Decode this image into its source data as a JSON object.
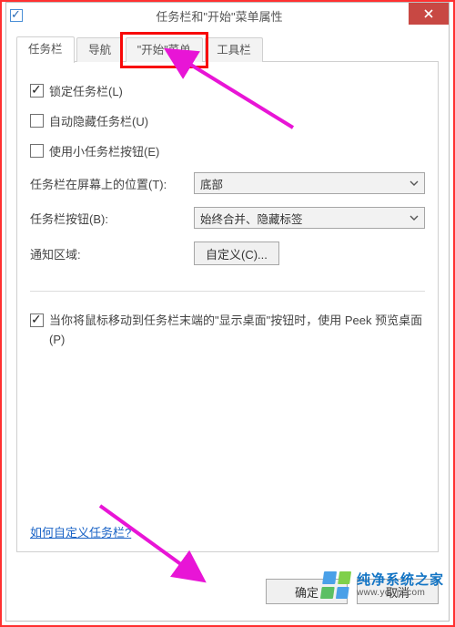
{
  "title": "任务栏和\"开始\"菜单属性",
  "tabs": {
    "taskbar": "任务栏",
    "navigation": "导航",
    "startmenu": "\"开始\"菜单",
    "toolbars": "工具栏"
  },
  "taskbarPanel": {
    "lockTaskbar": "锁定任务栏(L)",
    "autoHide": "自动隐藏任务栏(U)",
    "smallButtons": "使用小任务栏按钮(E)",
    "locationLabel": "任务栏在屏幕上的位置(T):",
    "locationValue": "底部",
    "buttonsLabel": "任务栏按钮(B):",
    "buttonsValue": "始终合并、隐藏标签",
    "notifyAreaLabel": "通知区域:",
    "customizeButton": "自定义(C)...",
    "peekCheckbox": "当你将鼠标移动到任务栏末端的\"显示桌面\"按钮时，使用 Peek 预览桌面(P)",
    "helpLink": "如何自定义任务栏?"
  },
  "footer": {
    "ok": "确定",
    "cancel": "取消"
  },
  "watermark": {
    "line1": "纯净系统之家",
    "line2": "www.ycwjz.com"
  },
  "checked": {
    "lockTaskbar": true,
    "autoHide": false,
    "smallButtons": false,
    "peek": true
  },
  "annotation": {
    "highlight_tab": "startmenu",
    "arrows": "magenta"
  }
}
